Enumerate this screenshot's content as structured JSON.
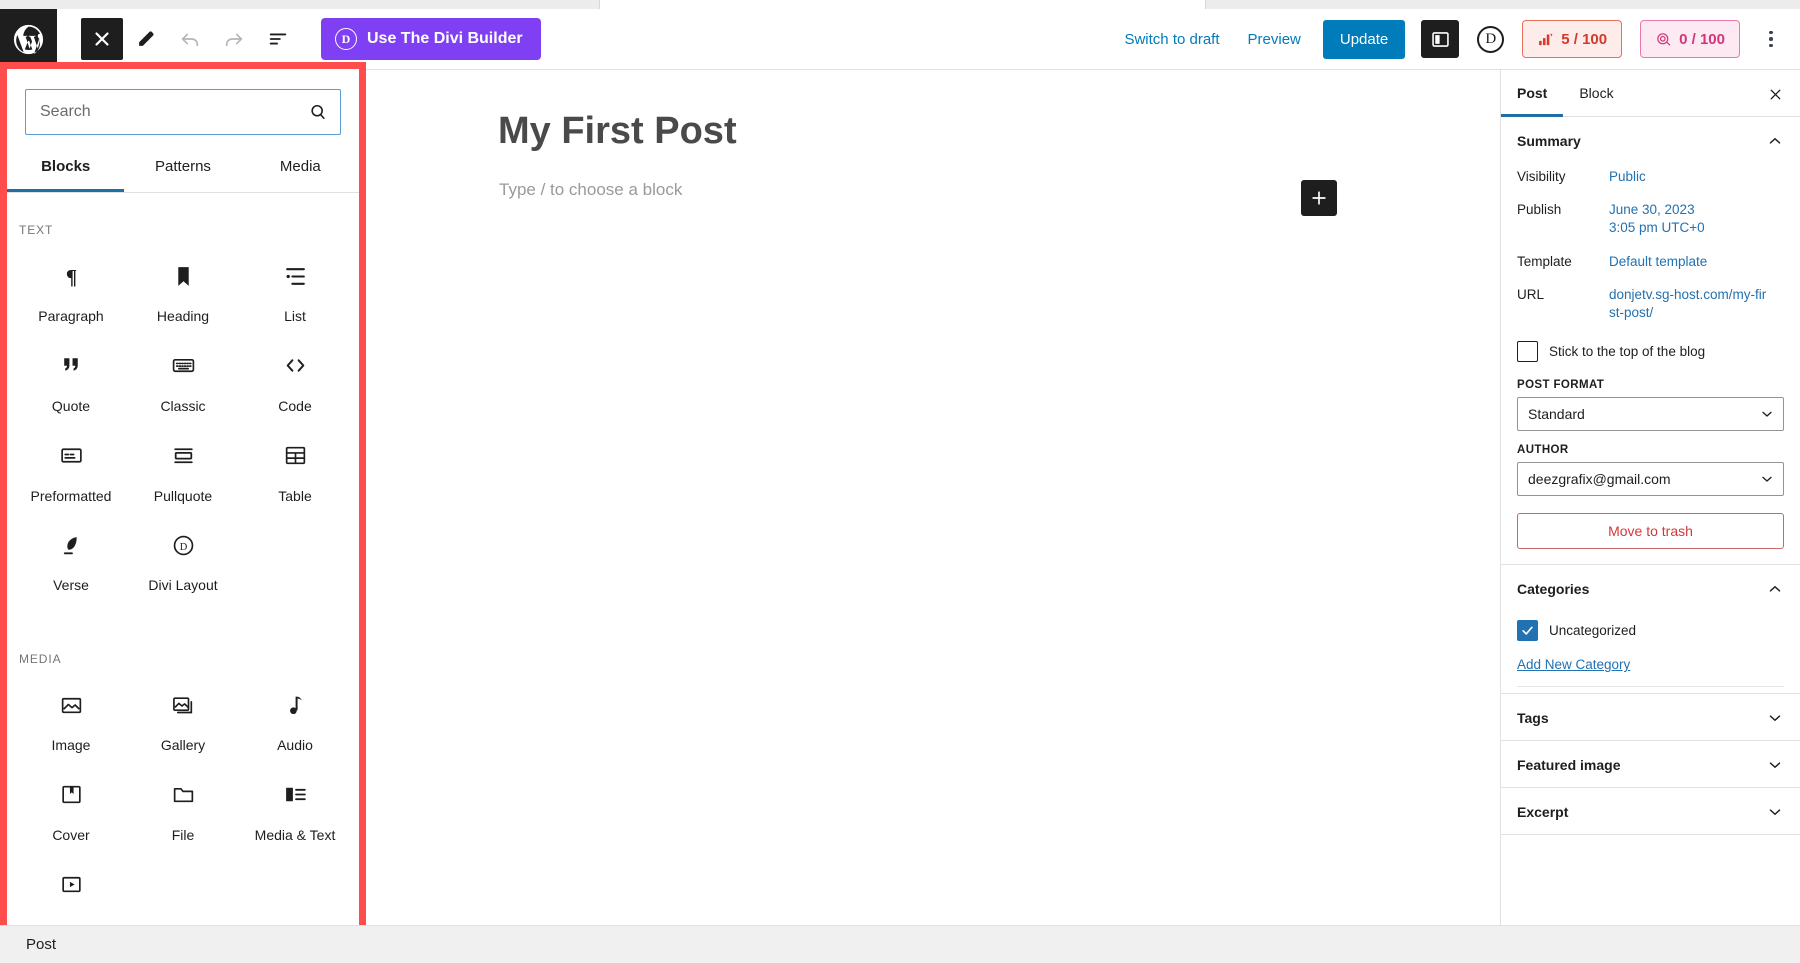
{
  "topbar": {
    "logo_icon": "wordpress-logo-icon",
    "close_icon": "close-x-icon",
    "edit_icon": "pencil-edit-icon",
    "undo_icon": "undo-arrow-icon",
    "redo_icon": "redo-arrow-icon",
    "list_view_icon": "document-outline-icon",
    "divi_button_label": "Use The Divi Builder",
    "divi_button_mark": "D",
    "divi_button_color": "#7f3ff2",
    "switch_to_draft_label": "Switch to draft",
    "preview_label": "Preview",
    "update_label": "Update",
    "update_color": "#007cba",
    "sidebar_toggle_icon": "settings-panel-icon",
    "divi_round_mark": "D",
    "seo_score": "5 / 100",
    "readability_score": "0 / 100",
    "seo_color": "#d13b2a",
    "readability_color": "#d1367d",
    "options_icon": "kebab-menu-icon"
  },
  "inserter": {
    "highlight_color": "#ff4d4d",
    "search": {
      "value": "",
      "placeholder": "Search",
      "icon": "search-icon"
    },
    "tabs": [
      {
        "label": "Blocks",
        "active": true
      },
      {
        "label": "Patterns",
        "active": false
      },
      {
        "label": "Media",
        "active": false
      }
    ],
    "groups": [
      {
        "label": "TEXT",
        "blocks": [
          {
            "label": "Paragraph",
            "icon": "paragraph-pilcrow-icon"
          },
          {
            "label": "Heading",
            "icon": "heading-bookmark-icon"
          },
          {
            "label": "List",
            "icon": "bulleted-list-icon"
          },
          {
            "label": "Quote",
            "icon": "quotation-mark-icon"
          },
          {
            "label": "Classic",
            "icon": "classic-keyboard-icon"
          },
          {
            "label": "Code",
            "icon": "code-brackets-icon"
          },
          {
            "label": "Preformatted",
            "icon": "preformatted-box-icon"
          },
          {
            "label": "Pullquote",
            "icon": "pullquote-bars-icon"
          },
          {
            "label": "Table",
            "icon": "table-grid-icon"
          },
          {
            "label": "Verse",
            "icon": "verse-feather-icon"
          },
          {
            "label": "Divi Layout",
            "icon": "divi-layout-circle-d-icon"
          }
        ]
      },
      {
        "label": "MEDIA",
        "blocks": [
          {
            "label": "Image",
            "icon": "image-picture-icon"
          },
          {
            "label": "Gallery",
            "icon": "gallery-stack-icon"
          },
          {
            "label": "Audio",
            "icon": "audio-note-icon"
          },
          {
            "label": "Cover",
            "icon": "cover-bookmark-icon"
          },
          {
            "label": "File",
            "icon": "file-folder-icon"
          },
          {
            "label": "Media & Text",
            "icon": "media-and-text-icon"
          },
          {
            "label": "",
            "icon": "video-play-icon"
          }
        ]
      }
    ]
  },
  "canvas": {
    "post_title": "My First Post",
    "block_placeholder": "Type / to choose a block",
    "add_block_icon": "plus-add-block-icon"
  },
  "settings": {
    "tabs": [
      {
        "label": "Post",
        "active": true
      },
      {
        "label": "Block",
        "active": false
      }
    ],
    "close_icon": "close-x-icon",
    "summary": {
      "title": "Summary",
      "chevron": "chevron-up-icon",
      "rows": [
        {
          "label": "Visibility",
          "value": "Public"
        },
        {
          "label": "Publish",
          "value": "June 30, 2023\n3:05 pm UTC+0"
        },
        {
          "label": "Template",
          "value": "Default template"
        },
        {
          "label": "URL",
          "value": "donjetv.sg-host.com/my-first-post/"
        }
      ],
      "sticky": {
        "label": "Stick to the top of the blog",
        "checked": false
      },
      "post_format": {
        "label": "POST FORMAT",
        "value": "Standard"
      },
      "author": {
        "label": "AUTHOR",
        "value": "deezgrafix@gmail.com"
      },
      "trash_label": "Move to trash",
      "trash_color": "#d63638"
    },
    "categories": {
      "title": "Categories",
      "chevron": "chevron-up-icon",
      "items": [
        {
          "label": "Uncategorized",
          "checked": true
        }
      ],
      "add_new_label": "Add New Category"
    },
    "collapsed": [
      {
        "title": "Tags",
        "chevron": "chevron-down-icon"
      },
      {
        "title": "Featured image",
        "chevron": "chevron-down-icon"
      },
      {
        "title": "Excerpt",
        "chevron": "chevron-down-icon"
      }
    ]
  },
  "statusbar": {
    "label": "Post"
  }
}
